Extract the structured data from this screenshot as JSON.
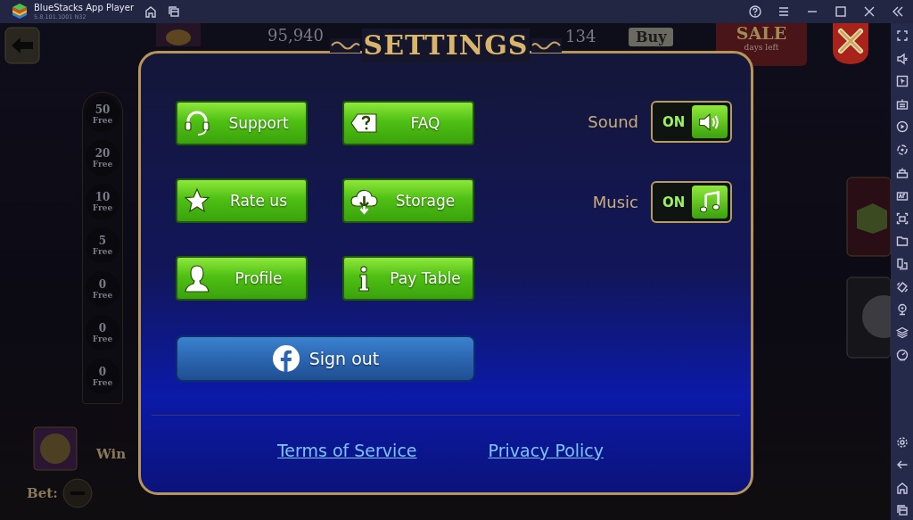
{
  "window": {
    "title": "BlueStacks App Player",
    "version": "5.8.101.1001 N32"
  },
  "game_background": {
    "coins": "95,940",
    "gems": "134",
    "buy_button": "Buy",
    "sale_badge": {
      "title": "SALE",
      "subtitle": "days left"
    },
    "free_spins_ladder": [
      {
        "count": "50",
        "label": "Free"
      },
      {
        "count": "20",
        "label": "Free"
      },
      {
        "count": "10",
        "label": "Free"
      },
      {
        "count": "5",
        "label": "Free"
      },
      {
        "count": "0",
        "label": "Free"
      },
      {
        "count": "0",
        "label": "Free"
      },
      {
        "count": "0",
        "label": "Free"
      }
    ],
    "win_label": "Win",
    "bet_label": "Bet:"
  },
  "settings_dialog": {
    "title": "SETTINGS",
    "buttons": [
      {
        "label": "Support",
        "kind": "headset"
      },
      {
        "label": "FAQ",
        "kind": "question"
      },
      {
        "label": "Rate us",
        "kind": "star"
      },
      {
        "label": "Storage",
        "kind": "cloud"
      },
      {
        "label": "Profile",
        "kind": "person"
      },
      {
        "label": "Pay Table",
        "kind": "info"
      }
    ],
    "sign_out": {
      "label": "Sign out",
      "kind": "facebook"
    },
    "toggles": [
      {
        "label": "Sound",
        "state_text": "ON",
        "on": true,
        "kind": "speaker"
      },
      {
        "label": "Music",
        "state_text": "ON",
        "on": true,
        "kind": "note"
      }
    ],
    "links": [
      "Terms of Service",
      "Privacy Policy"
    ]
  }
}
